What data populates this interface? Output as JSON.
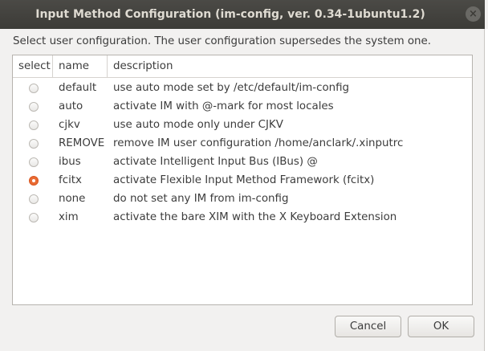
{
  "window": {
    "title": "Input Method Configuration (im-config, ver. 0.34-1ubuntu1.2)",
    "close_glyph": "×"
  },
  "prompt": "Select user configuration. The user configuration supersedes the system one.",
  "list": {
    "columns": {
      "select": "select",
      "name": "name",
      "description": "description"
    },
    "rows": [
      {
        "name": "default",
        "description": "use auto mode set by /etc/default/im-config",
        "selected": false
      },
      {
        "name": "auto",
        "description": "activate IM with @-mark for most locales",
        "selected": false
      },
      {
        "name": "cjkv",
        "description": "use auto mode only under CJKV",
        "selected": false
      },
      {
        "name": "REMOVE",
        "description": "remove IM user configuration /home/anclark/.xinputrc",
        "selected": false
      },
      {
        "name": "ibus",
        "description": "activate Intelligent Input Bus (IBus) @",
        "selected": false
      },
      {
        "name": "fcitx",
        "description": "activate Flexible Input Method Framework (fcitx)",
        "selected": true
      },
      {
        "name": "none",
        "description": "do not set any IM from im-config",
        "selected": false
      },
      {
        "name": "xim",
        "description": "activate the bare XIM with the X Keyboard Extension",
        "selected": false
      }
    ]
  },
  "buttons": {
    "cancel": "Cancel",
    "ok": "OK"
  },
  "colors": {
    "titlebar": "#3c3b37",
    "accent_radio": "#e96b33"
  }
}
